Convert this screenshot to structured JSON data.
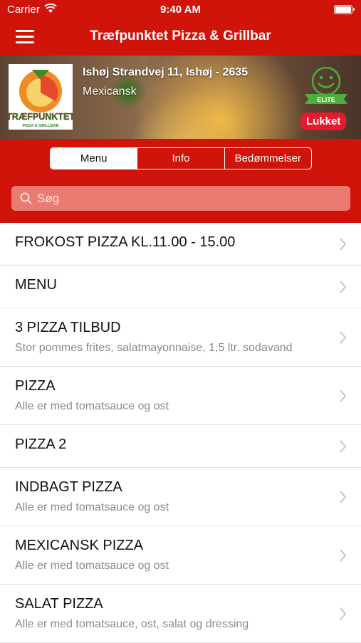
{
  "status_bar": {
    "carrier": "Carrier",
    "time": "9:40 AM"
  },
  "header": {
    "title": "Træfpunktet Pizza & Grillbar"
  },
  "restaurant": {
    "logo_text": "TRÆFPUNKTET",
    "logo_subtext": "PIZZA & GRILLBAR",
    "address": "Ishøj Strandvej 11, Ishøj - 2635",
    "cuisine": "Mexicansk",
    "elite_label": "ELITE",
    "status": "Lukket"
  },
  "tabs": [
    {
      "label": "Menu",
      "selected": true
    },
    {
      "label": "Info",
      "selected": false
    },
    {
      "label": "Bedømmelser",
      "selected": false
    }
  ],
  "search": {
    "placeholder": "Søg"
  },
  "menu_categories": [
    {
      "title": "FROKOST PIZZA KL.11.00 - 15.00",
      "subtitle": ""
    },
    {
      "title": "MENU",
      "subtitle": ""
    },
    {
      "title": "3 PIZZA TILBUD",
      "subtitle": "Stor pommes frites, salatmayonnaise, 1,5 ltr. sodavand"
    },
    {
      "title": "PIZZA",
      "subtitle": "Alle er med tomatsauce og ost"
    },
    {
      "title": "PIZZA 2",
      "subtitle": ""
    },
    {
      "title": "INDBAGT PIZZA",
      "subtitle": "Alle er med tomatsauce og ost"
    },
    {
      "title": "MEXICANSK PIZZA",
      "subtitle": "Alle er med tomatsauce og ost"
    },
    {
      "title": "SALAT PIZZA",
      "subtitle": "Alle er med tomatsauce, ost, salat og dressing"
    }
  ],
  "colors": {
    "brand_red": "#d0140a",
    "badge_red": "#e31b2c",
    "elite_green": "#4caf3a"
  }
}
